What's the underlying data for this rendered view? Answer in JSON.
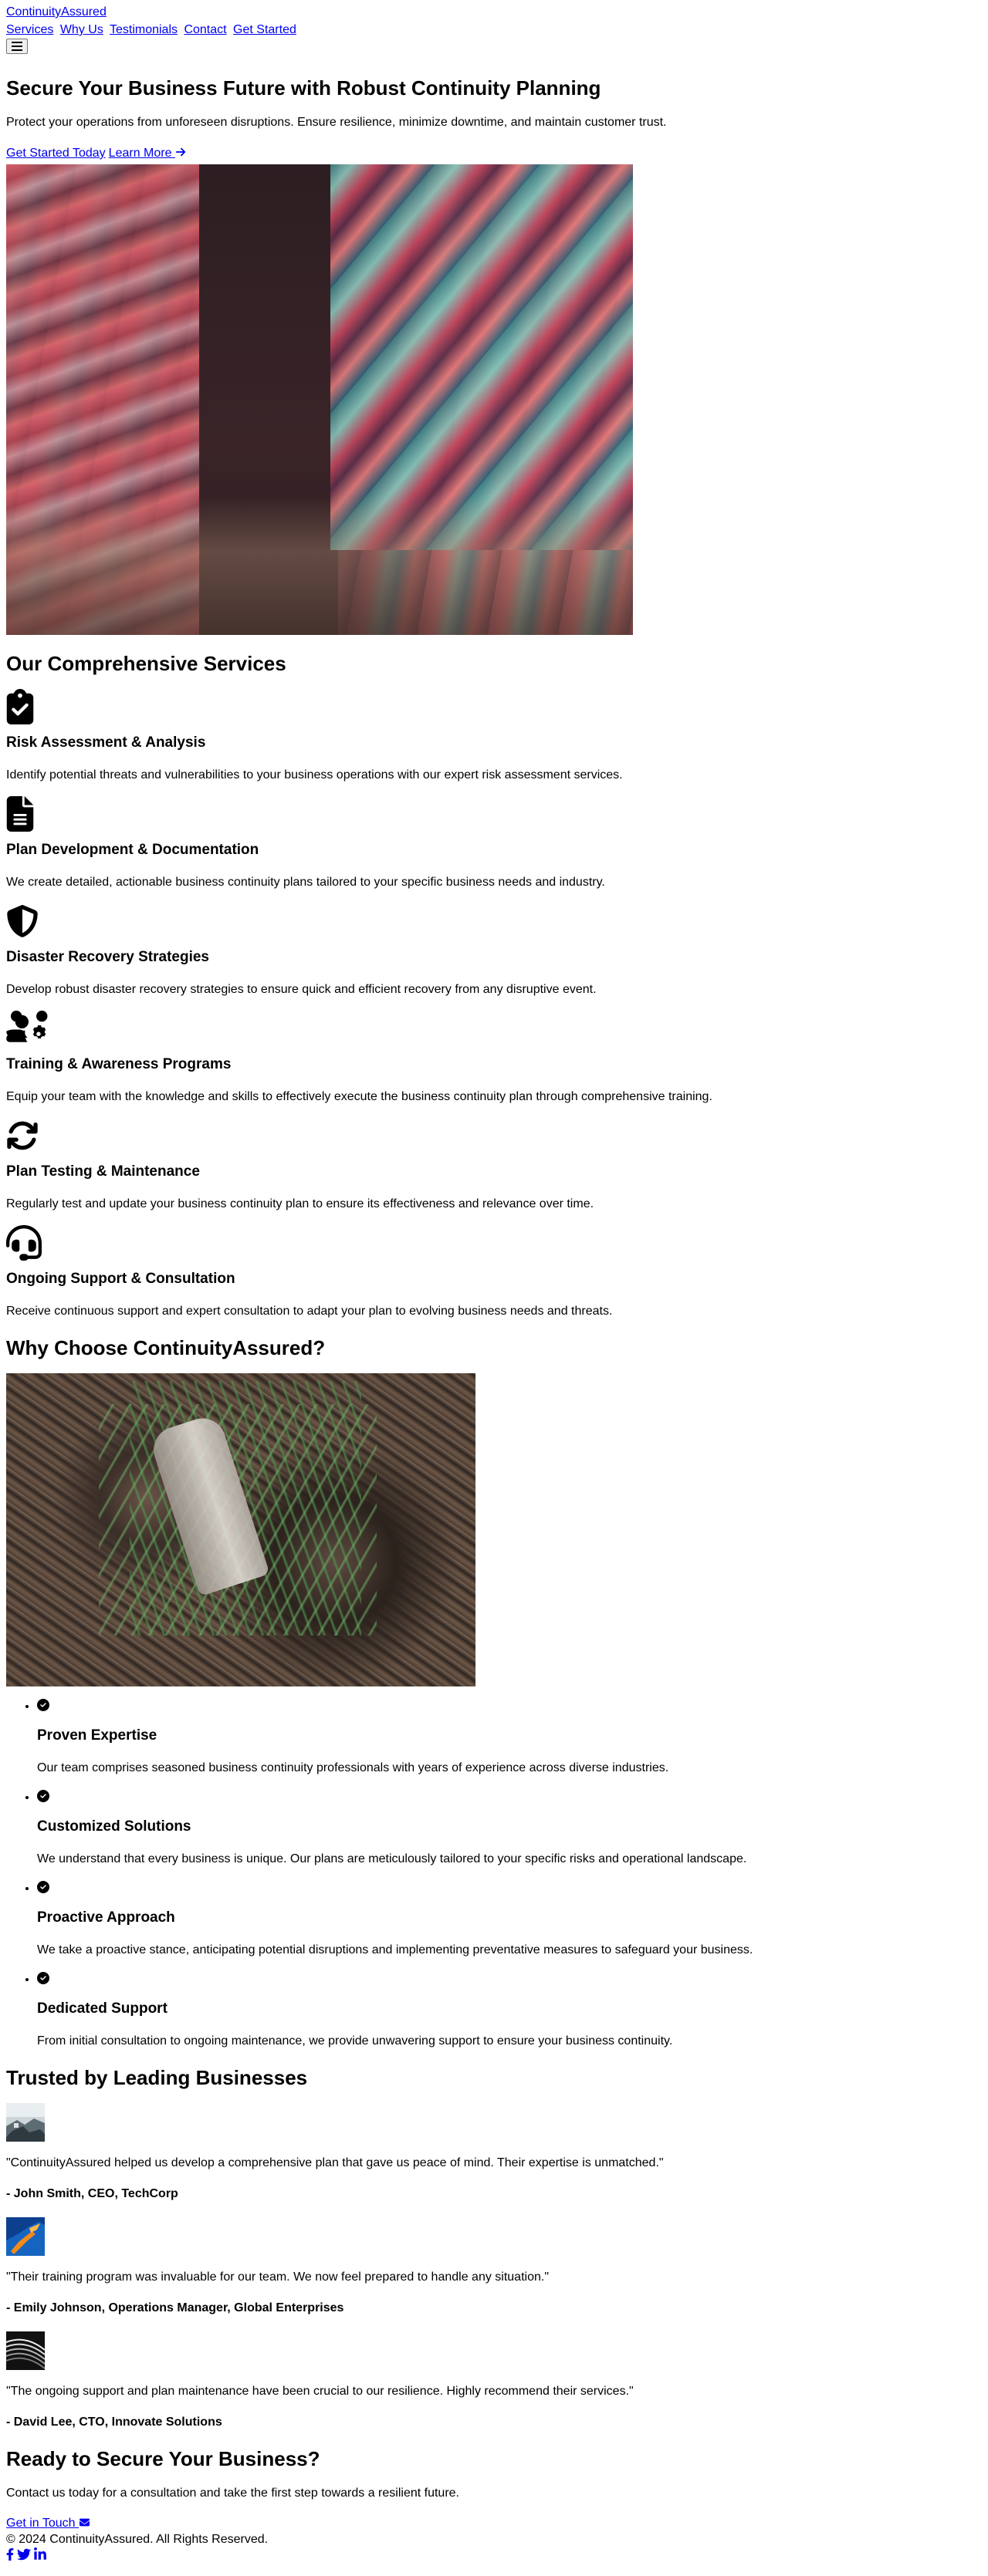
{
  "header": {
    "logo": "ContinuityAssured",
    "nav": [
      "Services",
      "Why Us",
      "Testimonials",
      "Contact",
      "Get Started"
    ],
    "menu_icon": "hamburger-menu-icon"
  },
  "hero": {
    "title": "Secure Your Business Future with Robust Continuity Planning",
    "subtitle": "Protect your operations from unforeseen disruptions. Ensure resilience, minimize downtime, and maintain customer trust.",
    "primary_cta": "Get Started Today",
    "secondary_cta": "Learn More",
    "secondary_cta_icon": "arrow-right-icon"
  },
  "services": {
    "heading": "Our Comprehensive Services",
    "items": [
      {
        "icon": "clipboard-check-icon",
        "title": "Risk Assessment & Analysis",
        "desc": "Identify potential threats and vulnerabilities to your business operations with our expert risk assessment services."
      },
      {
        "icon": "file-document-icon",
        "title": "Plan Development & Documentation",
        "desc": "We create detailed, actionable business continuity plans tailored to your specific business needs and industry."
      },
      {
        "icon": "shield-icon",
        "title": "Disaster Recovery Strategies",
        "desc": "Develop robust disaster recovery strategies to ensure quick and efficient recovery from any disruptive event."
      },
      {
        "icon": "users-gear-icon",
        "title": "Training & Awareness Programs",
        "desc": "Equip your team with the knowledge and skills to effectively execute the business continuity plan through comprehensive training."
      },
      {
        "icon": "sync-icon",
        "title": "Plan Testing & Maintenance",
        "desc": "Regularly test and update your business continuity plan to ensure its effectiveness and relevance over time."
      },
      {
        "icon": "headset-icon",
        "title": "Ongoing Support & Consultation",
        "desc": "Receive continuous support and expert consultation to adapt your plan to evolving business needs and threats."
      }
    ]
  },
  "why": {
    "heading": "Why Choose ContinuityAssured?",
    "items": [
      {
        "icon": "check-circle-icon",
        "title": "Proven Expertise",
        "desc": "Our team comprises seasoned business continuity professionals with years of experience across diverse industries."
      },
      {
        "icon": "check-circle-icon",
        "title": "Customized Solutions",
        "desc": "We understand that every business is unique. Our plans are meticulously tailored to your specific risks and operational landscape."
      },
      {
        "icon": "check-circle-icon",
        "title": "Proactive Approach",
        "desc": "We take a proactive stance, anticipating potential disruptions and implementing preventative measures to safeguard your business."
      },
      {
        "icon": "check-circle-icon",
        "title": "Dedicated Support",
        "desc": "From initial consultation to ongoing maintenance, we provide unwavering support to ensure your business continuity."
      }
    ]
  },
  "testimonials": {
    "heading": "Trusted by Leading Businesses",
    "items": [
      {
        "quote": "\"ContinuityAssured helped us develop a comprehensive plan that gave us peace of mind. Their expertise is unmatched.\"",
        "author": "- John Smith, CEO, TechCorp"
      },
      {
        "quote": "\"Their training program was invaluable for our team. We now feel prepared to handle any situation.\"",
        "author": "- Emily Johnson, Operations Manager, Global Enterprises"
      },
      {
        "quote": "\"The ongoing support and plan maintenance have been crucial to our resilience. Highly recommend their services.\"",
        "author": "- David Lee, CTO, Innovate Solutions"
      }
    ]
  },
  "cta": {
    "heading": "Ready to Secure Your Business?",
    "text": "Contact us today for a consultation and take the first step towards a resilient future.",
    "link": "Get in Touch",
    "link_icon": "envelope-icon"
  },
  "footer": {
    "copyright": "© 2024 ContinuityAssured. All Rights Reserved.",
    "social": [
      "facebook-icon",
      "twitter-icon",
      "linkedin-icon"
    ]
  },
  "colors": {
    "link": "#0000ee",
    "text": "#000000",
    "background": "#ffffff"
  }
}
